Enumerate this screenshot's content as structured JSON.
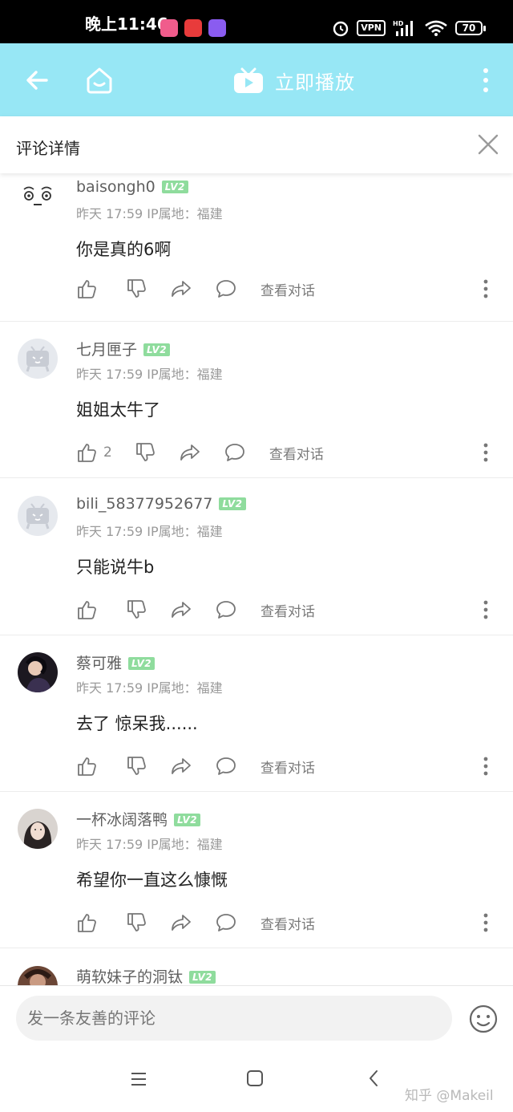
{
  "status_bar": {
    "time": "晚上11:46",
    "vpn": "VPN",
    "network": "HD",
    "battery": "70"
  },
  "top_bar": {
    "title": "立即播放"
  },
  "header": {
    "title": "评论详情"
  },
  "comments": [
    {
      "user": "baisongh0",
      "level": "LV2",
      "time": "昨天 17:59",
      "ip": "IP属地：福建",
      "text": "你是真的6啊",
      "likes": "",
      "view_conversation": "查看对话"
    },
    {
      "user": "七月匣子",
      "level": "LV2",
      "time": "昨天 17:59",
      "ip": "IP属地：福建",
      "text": "姐姐太牛了",
      "likes": "2",
      "view_conversation": "查看对话"
    },
    {
      "user": "bili_58377952677",
      "level": "LV2",
      "time": "昨天 17:59",
      "ip": "IP属地：福建",
      "text": "只能说牛b",
      "likes": "",
      "view_conversation": "查看对话"
    },
    {
      "user": "蔡可雅",
      "level": "LV2",
      "time": "昨天 17:59",
      "ip": "IP属地：福建",
      "text": "去了 惊呆我......",
      "likes": "",
      "view_conversation": "查看对话"
    },
    {
      "user": "一杯冰阔落鸭",
      "level": "LV2",
      "time": "昨天 17:59",
      "ip": "IP属地：福建",
      "text": "希望你一直这么慷慨",
      "likes": "",
      "view_conversation": "查看对话"
    },
    {
      "user": "萌软妹子的洞钛",
      "level": "LV2",
      "time": "",
      "ip": "",
      "text": "",
      "likes": "",
      "view_conversation": ""
    }
  ],
  "input": {
    "placeholder": "发一条友善的评论"
  },
  "watermark": "知乎 @Makeil",
  "colors": {
    "top_bar": "#97e7f5",
    "level_badge": "#8fdc9d"
  }
}
